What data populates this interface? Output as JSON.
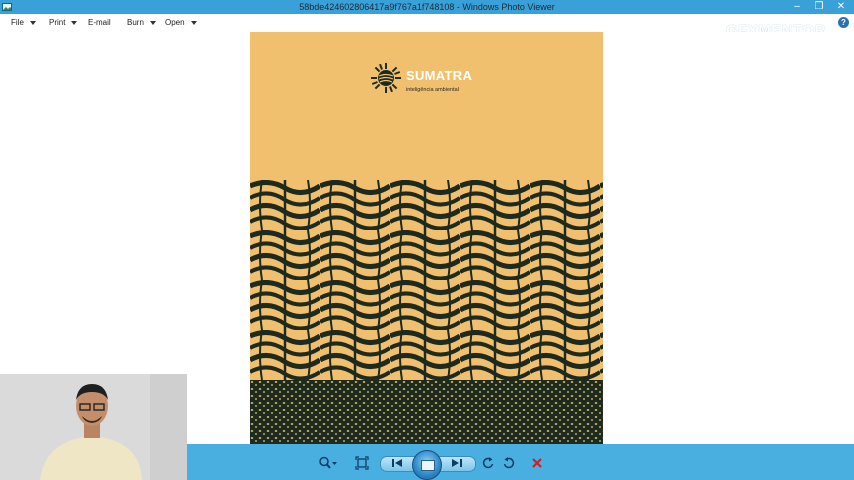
{
  "window": {
    "title": "58bde424602806417a9f767a1f748108 - Windows Photo Viewer",
    "controls": [
      "–",
      "❐",
      "✕"
    ]
  },
  "menu": {
    "file": "File",
    "print": "Print",
    "email": "E-mail",
    "burn": "Burn",
    "open": "Open",
    "help": "?"
  },
  "watermark": "GFXMENTOR",
  "poster": {
    "brand": "SUMATRA",
    "tagline": "inteligência ambiental",
    "colors": {
      "top": "#f0c06f",
      "stripe_dark": "#1e2a1d",
      "stripe_light": "#f0c06f"
    }
  },
  "toolbar": {
    "icons": [
      "zoom-icon",
      "fit-window-icon",
      "previous-icon",
      "slideshow-icon",
      "next-icon",
      "rotate-counterclockwise-icon",
      "rotate-clockwise-icon",
      "delete-icon"
    ],
    "accent": "#49aee0"
  }
}
